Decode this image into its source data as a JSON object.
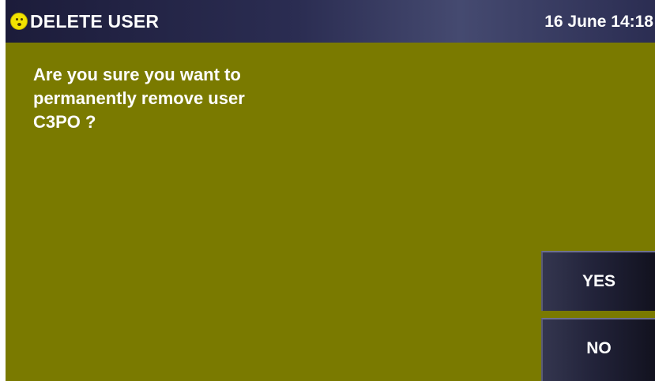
{
  "header": {
    "icon": "smiley-face-icon",
    "title": "DELETE USER",
    "datetime": "16 June 14:18"
  },
  "dialog": {
    "message_lines": [
      "Are you sure you want to",
      "permanently remove user",
      "C3PO ?"
    ]
  },
  "buttons": {
    "yes_label": "YES",
    "no_label": "NO"
  },
  "colors": {
    "background": "#7a7a00",
    "header": "#2b2d52",
    "button": "#22233a",
    "text": "#ffffff",
    "icon": "#f2e300"
  }
}
